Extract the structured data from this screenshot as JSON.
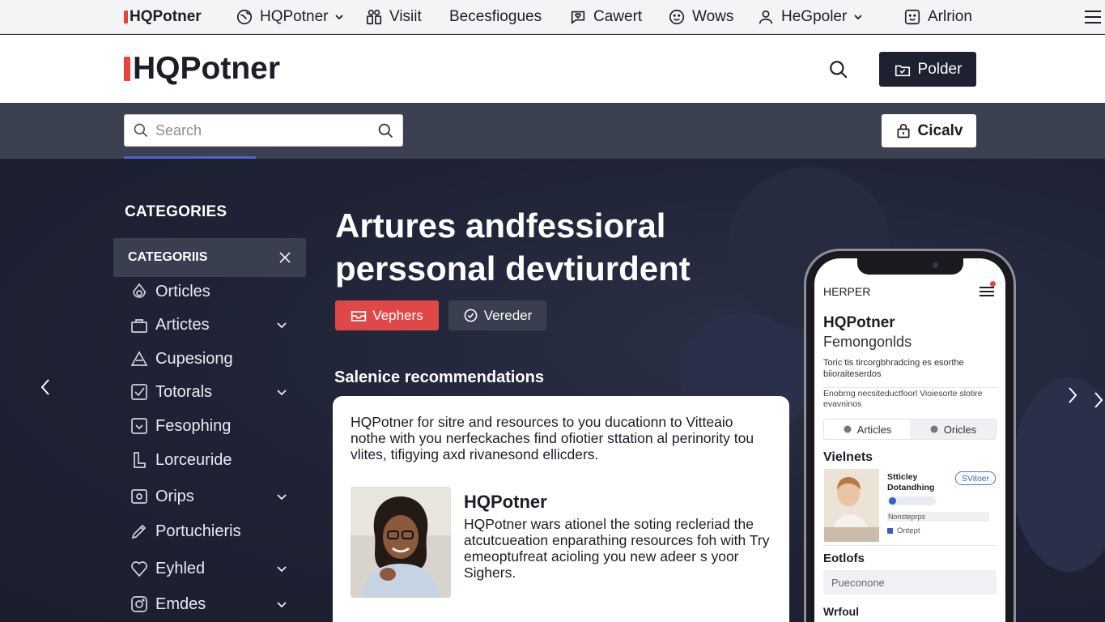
{
  "topnav": {
    "brand": "HQPotner",
    "items": [
      {
        "label": "HQPotner",
        "icon": "globe-icon",
        "dropdown": true
      },
      {
        "label": "Visiit",
        "icon": "people-icon",
        "dropdown": false
      },
      {
        "label": "Becesfiogues",
        "icon": "",
        "dropdown": false
      },
      {
        "label": "Cawert",
        "icon": "heart-chat-icon",
        "dropdown": false
      },
      {
        "label": "Wows",
        "icon": "smiley-icon",
        "dropdown": false
      },
      {
        "label": "HeGpoler",
        "icon": "user-icon",
        "dropdown": true
      },
      {
        "label": "Arlrion",
        "icon": "face-box-icon",
        "dropdown": false
      }
    ]
  },
  "header": {
    "brand": "HQPotner",
    "primary_button": "Polder"
  },
  "searchbar": {
    "placeholder": "Search",
    "action_button": "Cicalv"
  },
  "sidebar": {
    "title": "CATEGORIES",
    "active_item": "CATEGORIIS",
    "items": [
      {
        "label": "Orticles",
        "icon": "drop-icon",
        "chevron": false
      },
      {
        "label": "Artictes",
        "icon": "bag-icon",
        "chevron": true
      },
      {
        "label": "Cupesiong",
        "icon": "triangle-icon",
        "chevron": false
      },
      {
        "label": "Totorals",
        "icon": "checkbox-icon",
        "chevron": true
      },
      {
        "label": "Fesophing",
        "icon": "check-square-icon",
        "chevron": false
      },
      {
        "label": "Lorceuride",
        "icon": "page-icon",
        "chevron": false
      },
      {
        "label": "Orips",
        "icon": "frame-icon",
        "chevron": true
      },
      {
        "label": "Portuchieris",
        "icon": "pencil-icon",
        "chevron": false
      },
      {
        "label": "Eyhled",
        "icon": "heart-outline-icon",
        "chevron": true
      },
      {
        "label": "Emdes",
        "icon": "camera-icon",
        "chevron": true
      }
    ]
  },
  "hero": {
    "title_line1": "Artures andfessioral",
    "title_line2": "perssonal devtiurdent",
    "btn_primary": "Vephers",
    "btn_secondary": "Vereder",
    "rec_title": "Salenice recommendations"
  },
  "card": {
    "intro": "HQPotner for sitre and resources to you ducationn to Vitteaio nothe with you nerfeckaches find ofiotier sttation al perinority tou vlites, tifigying axd rivanesond ellicders.",
    "person_name": "HQPotner",
    "person_desc": "HQPotner wars ationel the soting recleriad the atcutcueation enparathing resources foh with Try emeoptufreat acioling you new adeer s yoor Sighers."
  },
  "phone": {
    "header": "HERPER",
    "brand": "HQPotner",
    "subtitle": "Femongonlds",
    "desc1": "Toric tis tircorgbhradcing es esorthe biioraiteserdos",
    "desc2": "Enobrng necsiteductfoorl Vioiesorte slotire evavninos",
    "tab1": "Articles",
    "tab2": "Oricles",
    "section1": "Vielnets",
    "item_title": "Stticley Dotandhing",
    "item_badge": "SVitoer",
    "item_line2": "Nonsteprps",
    "item_line3": "Ontept",
    "section2": "Eotlofs",
    "input_placeholder": "Pueconone",
    "section3": "Wrfoul"
  },
  "colors": {
    "accent_red": "#e04848",
    "dark": "#1d2130",
    "accent_blue": "#4f63d8"
  }
}
